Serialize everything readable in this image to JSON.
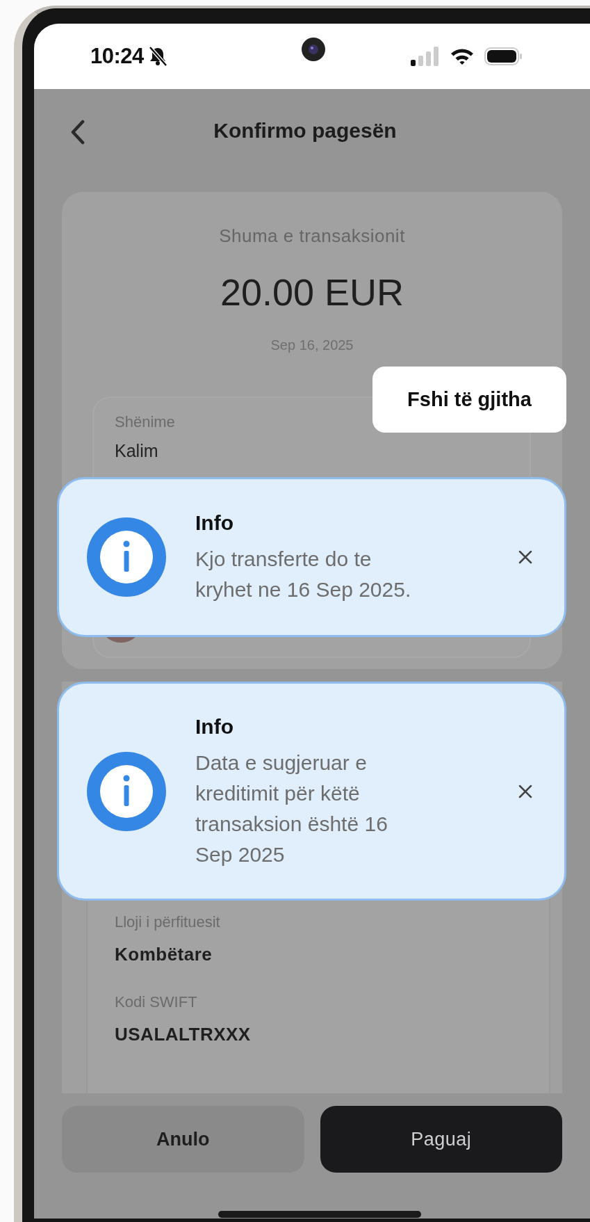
{
  "status_bar": {
    "time": "10:24"
  },
  "header": {
    "title": "Konfirmo pagesën"
  },
  "summary": {
    "label": "Shuma e transaksionit",
    "amount": "20.00 EUR",
    "date": "Sep 16, 2025",
    "note_label": "Shënime",
    "note_value": "Kalim"
  },
  "clear_all_button": "Fshi të gjitha",
  "toasts": [
    {
      "title": "Info",
      "message": "Kjo transferte do te\nkryhet ne 16 Sep 2025."
    },
    {
      "title": "Info",
      "message": "Data e sugjeruar e\nkreditimit për këtë\ntransaksion është 16\nSep 2025"
    }
  ],
  "beneficiary_details": [
    {
      "label": "Lloji i përfituesit",
      "value": "Kombëtare"
    },
    {
      "label": "Kodi SWIFT",
      "value": "USALALTRXXX"
    }
  ],
  "buttons": {
    "cancel": "Anulo",
    "pay": "Paguaj"
  }
}
